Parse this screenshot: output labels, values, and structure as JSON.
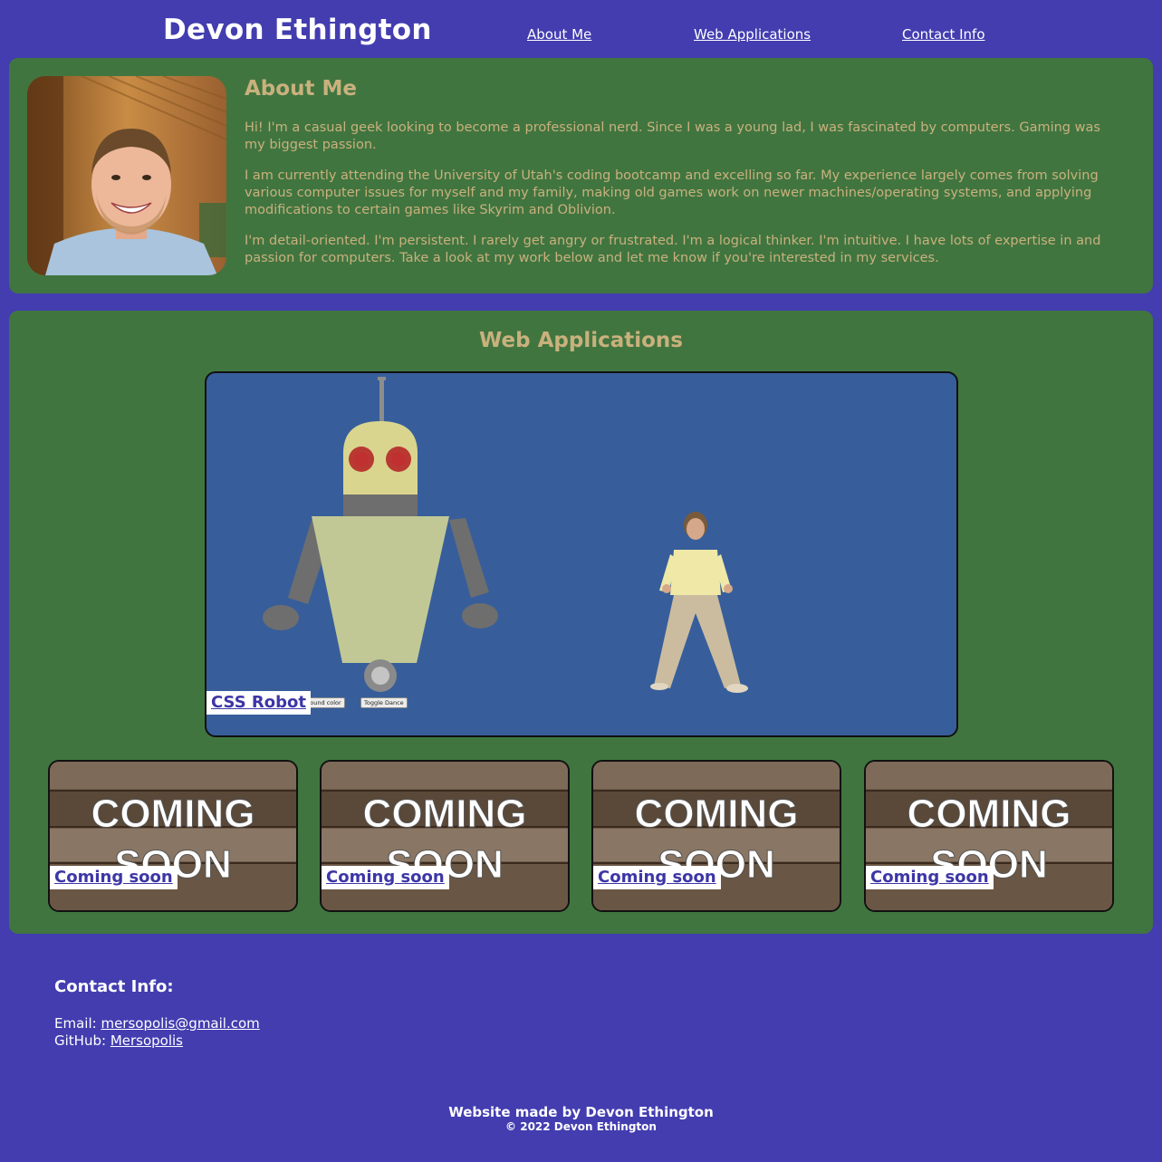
{
  "header": {
    "title": "Devon Ethington",
    "nav": {
      "about": "About Me",
      "web_apps": "Web Applications",
      "contact": "Contact Info"
    }
  },
  "about": {
    "heading": "About Me",
    "paragraphs": [
      "Hi! I'm a casual geek looking to become a professional nerd. Since I was a young lad, I was fascinated by computers. Gaming was my biggest passion.",
      "I am currently attending the University of Utah's coding bootcamp and excelling so far. My experience largely comes from solving various computer issues for myself and my family, making old games work on newer machines/operating systems, and applying modifications to certain games like Skyrim and Oblivion.",
      "I'm detail-oriented. I'm persistent. I rarely get angry or frustrated. I'm a logical thinker. I'm intuitive. I have lots of expertise in and passion for computers. Take a look at my work below and let me know if you're interested in my services."
    ]
  },
  "web_apps": {
    "heading": "Web Applications",
    "main_project": {
      "label": "CSS Robot",
      "buttons": [
        "Randomize background color",
        "Toggle Dance"
      ]
    },
    "coming_cards": [
      {
        "image_text_1": "COMING",
        "image_text_2": "SOON",
        "label": "Coming soon"
      },
      {
        "image_text_1": "COMING",
        "image_text_2": "SOON",
        "label": "Coming soon"
      },
      {
        "image_text_1": "COMING",
        "image_text_2": "SOON",
        "label": "Coming soon"
      },
      {
        "image_text_1": "COMING",
        "image_text_2": "SOON",
        "label": "Coming soon"
      }
    ]
  },
  "contact": {
    "heading": "Contact Info:",
    "email_prefix": "Email: ",
    "email": "mersopolis@gmail.com",
    "github_prefix": "GitHub: ",
    "github": "Mersopolis"
  },
  "footer": {
    "made_by": "Website made by Devon Ethington",
    "copyright": "© 2022 Devon Ethington"
  },
  "colors": {
    "page_bg": "#433db0",
    "panel_bg": "#417540",
    "heading_tan": "#c9b17d",
    "project_bg": "#375e9b",
    "label_text": "#3d36a6"
  }
}
